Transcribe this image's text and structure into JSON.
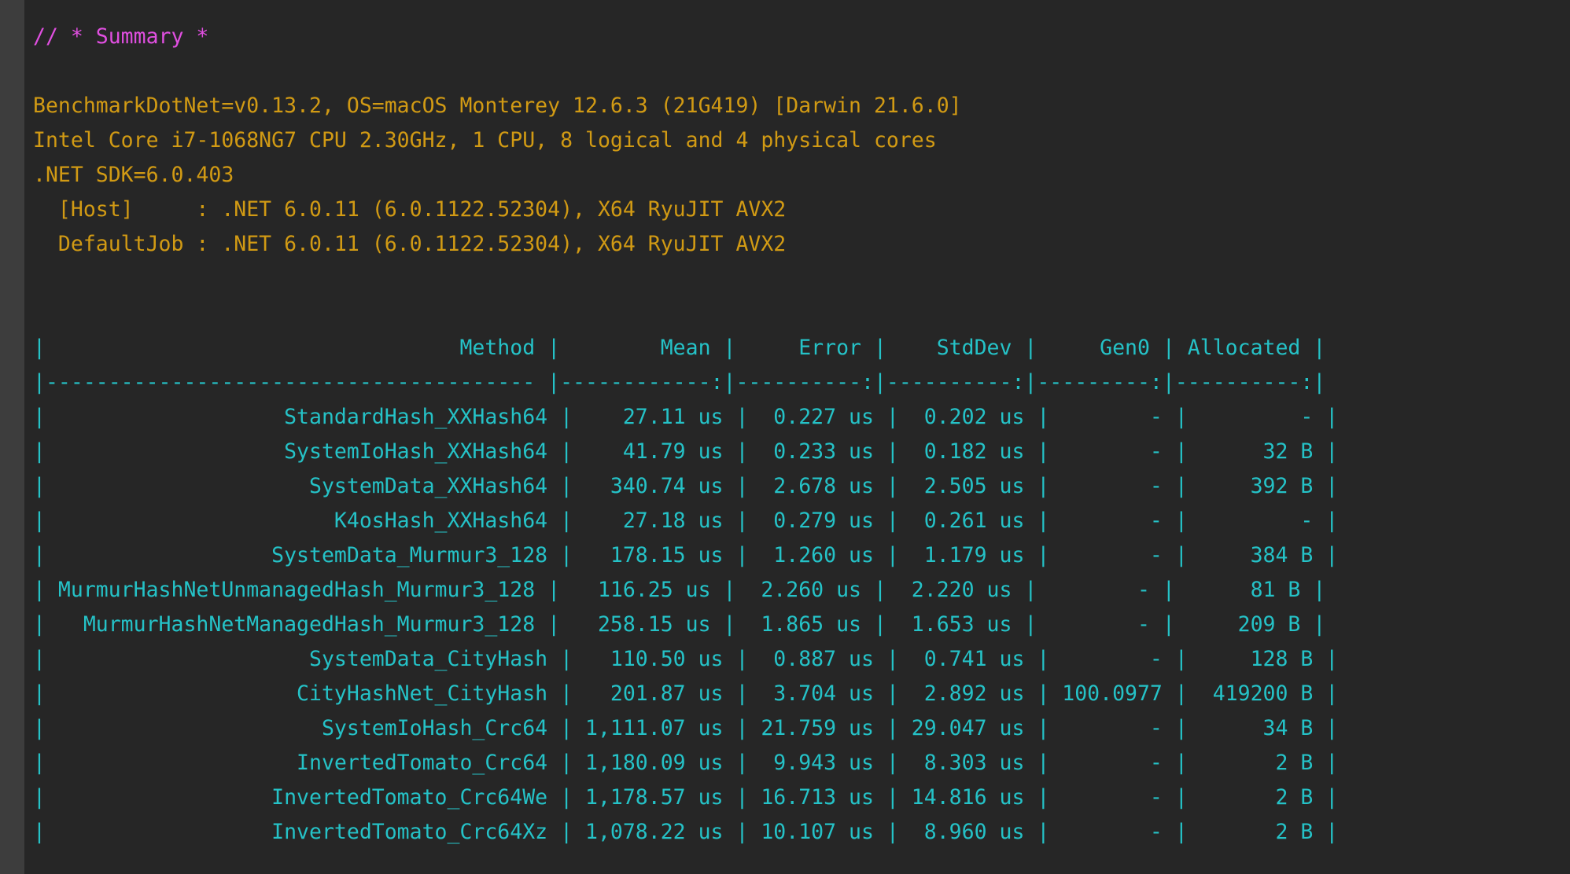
{
  "summary_comment": "// * Summary *",
  "environment": [
    "BenchmarkDotNet=v0.13.2, OS=macOS Monterey 12.6.3 (21G419) [Darwin 21.6.0]",
    "Intel Core i7-1068NG7 CPU 2.30GHz, 1 CPU, 8 logical and 4 physical cores",
    ".NET SDK=6.0.403",
    "  [Host]     : .NET 6.0.11 (6.0.1122.52304), X64 RyuJIT AVX2",
    "  DefaultJob : .NET 6.0.11 (6.0.1122.52304), X64 RyuJIT AVX2"
  ],
  "table": {
    "header": "|                                 Method |        Mean |     Error |    StdDev |     Gen0 | Allocated |",
    "separator": "|--------------------------------------- |------------:|----------:|----------:|---------:|----------:|",
    "rows": [
      "|                   StandardHash_XXHash64 |    27.11 us |  0.227 us |  0.202 us |        - |         - |",
      "|                   SystemIoHash_XXHash64 |    41.79 us |  0.233 us |  0.182 us |        - |      32 B |",
      "|                     SystemData_XXHash64 |   340.74 us |  2.678 us |  2.505 us |        - |     392 B |",
      "|                       K4osHash_XXHash64 |    27.18 us |  0.279 us |  0.261 us |        - |         - |",
      "|                  SystemData_Murmur3_128 |   178.15 us |  1.260 us |  1.179 us |        - |     384 B |",
      "| MurmurHashNetUnmanagedHash_Murmur3_128 |   116.25 us |  2.260 us |  2.220 us |        - |      81 B |",
      "|   MurmurHashNetManagedHash_Murmur3_128 |   258.15 us |  1.865 us |  1.653 us |        - |     209 B |",
      "|                     SystemData_CityHash |   110.50 us |  0.887 us |  0.741 us |        - |     128 B |",
      "|                    CityHashNet_CityHash |   201.87 us |  3.704 us |  2.892 us | 100.0977 |  419200 B |",
      "|                      SystemIoHash_Crc64 | 1,111.07 us | 21.759 us | 29.047 us |        - |      34 B |",
      "|                    InvertedTomato_Crc64 | 1,180.09 us |  9.943 us |  8.303 us |        - |       2 B |",
      "|                  InvertedTomato_Crc64We | 1,178.57 us | 16.713 us | 14.816 us |        - |       2 B |",
      "|                  InvertedTomato_Crc64Xz | 1,078.22 us | 10.107 us |  8.960 us |        - |       2 B |"
    ]
  },
  "colors": {
    "background": "#262626",
    "gutter": "#3d3d3d",
    "summary": "#e04fe0",
    "info": "#d19a14",
    "table": "#25c2c7"
  }
}
